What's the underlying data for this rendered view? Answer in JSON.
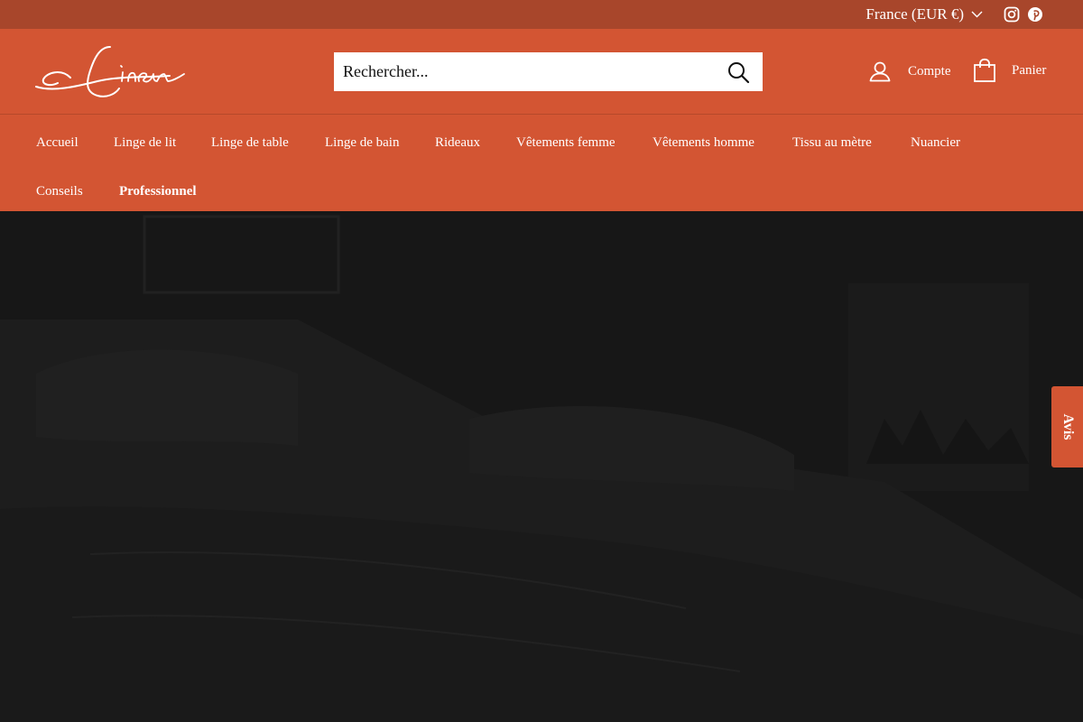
{
  "utility_bar": {
    "currency_label": "France (EUR €)",
    "social": [
      "instagram-icon",
      "pinterest-icon"
    ]
  },
  "header": {
    "logo_text": "Linen",
    "search": {
      "placeholder": "Rechercher..."
    },
    "account_label": "Compte",
    "cart_label": "Panier"
  },
  "nav": {
    "items": [
      "Accueil",
      "Linge de lit",
      "Linge de table",
      "Linge de bain",
      "Rideaux",
      "Vêtements femme",
      "Vêtements homme",
      "Tissu au mètre",
      "Nuancier",
      "Conseils",
      "Professionnel"
    ]
  },
  "reviews_tab": {
    "label": "Avis"
  },
  "colors": {
    "utility_bar": "#a8462b",
    "header": "#d35533",
    "hero": "#171717",
    "text": "#ffffff"
  }
}
